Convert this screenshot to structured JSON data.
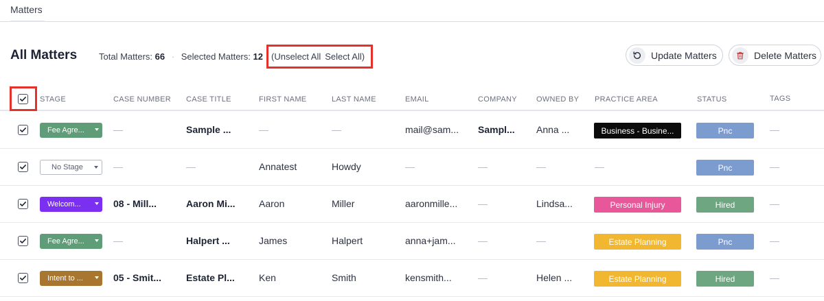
{
  "topbar": {
    "tab": "Matters"
  },
  "title": "All Matters",
  "stats": {
    "total_label": "Total Matters:",
    "total_value": "66",
    "selected_label": "Selected Matters:",
    "selected_value": "12",
    "unselect_all": "(Unselect All",
    "select_all": "Select All)"
  },
  "buttons": {
    "update": "Update Matters",
    "delete": "Delete Matters"
  },
  "columns": [
    "STAGE",
    "CASE NUMBER",
    "CASE TITLE",
    "FIRST NAME",
    "LAST NAME",
    "EMAIL",
    "COMPANY",
    "OWNED BY",
    "PRACTICE AREA",
    "STATUS",
    "TAGS"
  ],
  "header_checked": true,
  "rows": [
    {
      "checked": true,
      "stage": "Fee Agre...",
      "stage_color": "#5e9d77",
      "stage_outline": false,
      "case_number": "—",
      "case_title": "Sample ...",
      "first_name": "—",
      "last_name": "—",
      "email": "mail@sam...",
      "company": "Sampl...",
      "owned_by": "Anna ...",
      "practice_area": "Business - Busine...",
      "practice_area_color": "#0b0b0b",
      "status": "Pnc",
      "status_color": "#7c9bcf",
      "tags": "—"
    },
    {
      "checked": true,
      "stage": "No Stage",
      "stage_color": "#ffffff",
      "stage_outline": true,
      "case_number": "—",
      "case_title": "—",
      "first_name": "Annatest",
      "last_name": "Howdy",
      "email": "—",
      "company": "—",
      "owned_by": "—",
      "practice_area": "—",
      "practice_area_color": "",
      "status": "Pnc",
      "status_color": "#7c9bcf",
      "tags": "—"
    },
    {
      "checked": true,
      "stage": "Welcom...",
      "stage_color": "#7b2ff0",
      "stage_outline": false,
      "case_number": "08 - Mill...",
      "case_title": "Aaron Mi...",
      "first_name": "Aaron",
      "last_name": "Miller",
      "email": "aaronmille...",
      "company": "—",
      "owned_by": "Lindsa...",
      "practice_area": "Personal Injury",
      "practice_area_color": "#e8579a",
      "status": "Hired",
      "status_color": "#6ea682",
      "tags": "—"
    },
    {
      "checked": true,
      "stage": "Fee Agre...",
      "stage_color": "#5e9d77",
      "stage_outline": false,
      "case_number": "—",
      "case_title": "Halpert ...",
      "first_name": "James",
      "last_name": "Halpert",
      "email": "anna+jam...",
      "company": "—",
      "owned_by": "—",
      "practice_area": "Estate Planning",
      "practice_area_color": "#f2b730",
      "status": "Pnc",
      "status_color": "#7c9bcf",
      "tags": "—"
    },
    {
      "checked": true,
      "stage": "Intent to ...",
      "stage_color": "#a8762f",
      "stage_outline": false,
      "case_number": "05 - Smit...",
      "case_title": "Estate Pl...",
      "first_name": "Ken",
      "last_name": "Smith",
      "email": "kensmith...",
      "company": "—",
      "owned_by": "Helen ...",
      "practice_area": "Estate Planning",
      "practice_area_color": "#f2b730",
      "status": "Hired",
      "status_color": "#6ea682",
      "tags": "—"
    }
  ]
}
